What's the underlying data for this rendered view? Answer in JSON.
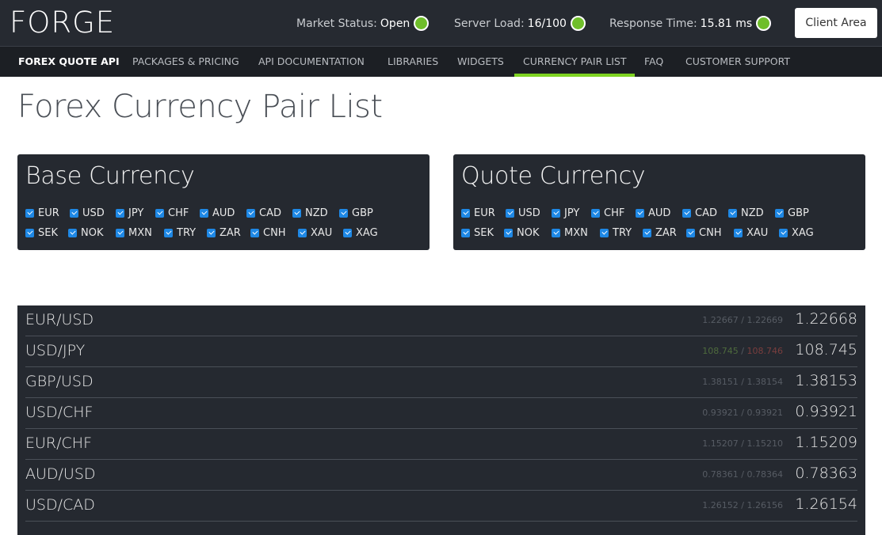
{
  "header": {
    "logo": "FORGE",
    "market_status": {
      "label": "Market Status:",
      "value": "Open",
      "indicator": "green-dot"
    },
    "server_load": {
      "label": "Server Load:",
      "value": "16/100",
      "indicator": "green-dot"
    },
    "response_time": {
      "label": "Response Time:",
      "value": "15.81 ms",
      "indicator": "green-dot"
    },
    "client_area_label": "Client Area"
  },
  "nav": {
    "items": [
      {
        "label": "FOREX QUOTE API",
        "brand": true
      },
      {
        "label": "PACKAGES & PRICING"
      },
      {
        "label": "API DOCUMENTATION"
      },
      {
        "label": "LIBRARIES"
      },
      {
        "label": "WIDGETS"
      },
      {
        "label": "CURRENCY PAIR LIST",
        "active": true
      },
      {
        "label": "FAQ"
      },
      {
        "label": "CUSTOMER SUPPORT"
      }
    ],
    "active_color": "#7ed321"
  },
  "page": {
    "title": "Forex Currency Pair List"
  },
  "base_currency": {
    "title": "Base Currency",
    "options": [
      {
        "code": "EUR",
        "checked": true
      },
      {
        "code": "USD",
        "checked": true
      },
      {
        "code": "JPY",
        "checked": true
      },
      {
        "code": "CHF",
        "checked": true
      },
      {
        "code": "AUD",
        "checked": true
      },
      {
        "code": "CAD",
        "checked": true
      },
      {
        "code": "NZD",
        "checked": true
      },
      {
        "code": "GBP",
        "checked": true
      },
      {
        "code": "SEK",
        "checked": true
      },
      {
        "code": "NOK",
        "checked": true
      },
      {
        "code": "MXN",
        "checked": true
      },
      {
        "code": "TRY",
        "checked": true
      },
      {
        "code": "ZAR",
        "checked": true
      },
      {
        "code": "CNH",
        "checked": true
      },
      {
        "code": "XAU",
        "checked": true
      },
      {
        "code": "XAG",
        "checked": true
      }
    ]
  },
  "quote_currency": {
    "title": "Quote Currency",
    "options": [
      {
        "code": "EUR",
        "checked": true
      },
      {
        "code": "USD",
        "checked": true
      },
      {
        "code": "JPY",
        "checked": true
      },
      {
        "code": "CHF",
        "checked": true
      },
      {
        "code": "AUD",
        "checked": true
      },
      {
        "code": "CAD",
        "checked": true
      },
      {
        "code": "NZD",
        "checked": true
      },
      {
        "code": "GBP",
        "checked": true
      },
      {
        "code": "SEK",
        "checked": true
      },
      {
        "code": "NOK",
        "checked": true
      },
      {
        "code": "MXN",
        "checked": true
      },
      {
        "code": "TRY",
        "checked": true
      },
      {
        "code": "ZAR",
        "checked": true
      },
      {
        "code": "CNH",
        "checked": true
      },
      {
        "code": "XAU",
        "checked": true
      },
      {
        "code": "XAG",
        "checked": true
      }
    ]
  },
  "rates": [
    {
      "pair": "EUR/USD",
      "bid": "1.22667",
      "ask": "1.22669",
      "mid": "1.22668",
      "trend": ""
    },
    {
      "pair": "USD/JPY",
      "bid": "108.745",
      "ask": "108.746",
      "mid": "108.745",
      "trend": "mixed"
    },
    {
      "pair": "GBP/USD",
      "bid": "1.38151",
      "ask": "1.38154",
      "mid": "1.38153",
      "trend": ""
    },
    {
      "pair": "USD/CHF",
      "bid": "0.93921",
      "ask": "0.93921",
      "mid": "0.93921",
      "trend": ""
    },
    {
      "pair": "EUR/CHF",
      "bid": "1.15207",
      "ask": "1.15210",
      "mid": "1.15209",
      "trend": ""
    },
    {
      "pair": "AUD/USD",
      "bid": "0.78361",
      "ask": "0.78364",
      "mid": "0.78363",
      "trend": ""
    },
    {
      "pair": "USD/CAD",
      "bid": "1.26152",
      "ask": "1.26156",
      "mid": "1.26154",
      "trend": ""
    }
  ]
}
